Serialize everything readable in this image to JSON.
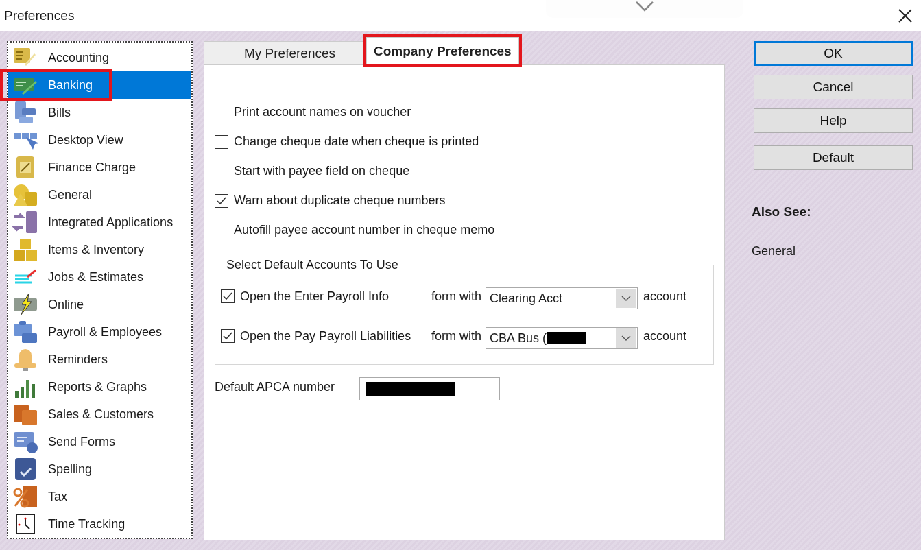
{
  "window": {
    "title": "Preferences"
  },
  "sidebar": {
    "items": [
      {
        "label": "Accounting",
        "selected": false,
        "highlighted": false
      },
      {
        "label": "Banking",
        "selected": true,
        "highlighted": true
      },
      {
        "label": "Bills",
        "selected": false,
        "highlighted": false
      },
      {
        "label": "Desktop View",
        "selected": false,
        "highlighted": false
      },
      {
        "label": "Finance Charge",
        "selected": false,
        "highlighted": false
      },
      {
        "label": "General",
        "selected": false,
        "highlighted": false
      },
      {
        "label": "Integrated Applications",
        "selected": false,
        "highlighted": false
      },
      {
        "label": "Items & Inventory",
        "selected": false,
        "highlighted": false
      },
      {
        "label": "Jobs & Estimates",
        "selected": false,
        "highlighted": false
      },
      {
        "label": "Online",
        "selected": false,
        "highlighted": false
      },
      {
        "label": "Payroll & Employees",
        "selected": false,
        "highlighted": false
      },
      {
        "label": "Reminders",
        "selected": false,
        "highlighted": false
      },
      {
        "label": "Reports & Graphs",
        "selected": false,
        "highlighted": false
      },
      {
        "label": "Sales & Customers",
        "selected": false,
        "highlighted": false
      },
      {
        "label": "Send Forms",
        "selected": false,
        "highlighted": false
      },
      {
        "label": "Spelling",
        "selected": false,
        "highlighted": false
      },
      {
        "label": "Tax",
        "selected": false,
        "highlighted": false
      },
      {
        "label": "Time Tracking",
        "selected": false,
        "highlighted": false
      }
    ]
  },
  "tabs": [
    {
      "label": "My Preferences",
      "selected": false,
      "highlighted": false
    },
    {
      "label": "Company Preferences",
      "selected": true,
      "highlighted": true
    }
  ],
  "options": [
    {
      "label": "Print account names on voucher",
      "checked": false
    },
    {
      "label": "Change cheque date when cheque is printed",
      "checked": false
    },
    {
      "label": "Start with payee field on cheque",
      "checked": false
    },
    {
      "label": "Warn about duplicate cheque numbers",
      "checked": true
    },
    {
      "label": "Autofill payee account number in cheque memo",
      "checked": false
    }
  ],
  "default_accounts": {
    "title": "Select Default Accounts To Use",
    "rows": [
      {
        "label": "Open the Enter Payroll Info",
        "checked": true,
        "form_with": "form with",
        "account": "Clearing Acct",
        "redacted": false,
        "suffix": "account"
      },
      {
        "label": "Open the Pay Payroll Liabilities",
        "checked": true,
        "form_with": "form with",
        "account": "CBA Bus (",
        "redacted": true,
        "suffix": "account"
      }
    ]
  },
  "apca": {
    "label": "Default APCA number",
    "redacted": true
  },
  "buttons": [
    {
      "label": "OK",
      "default": true
    },
    {
      "label": "Cancel",
      "default": false
    },
    {
      "label": "Help",
      "default": false
    },
    {
      "label": "Default",
      "default": false
    }
  ],
  "also_see": {
    "title": "Also See:",
    "links": [
      "General"
    ]
  }
}
